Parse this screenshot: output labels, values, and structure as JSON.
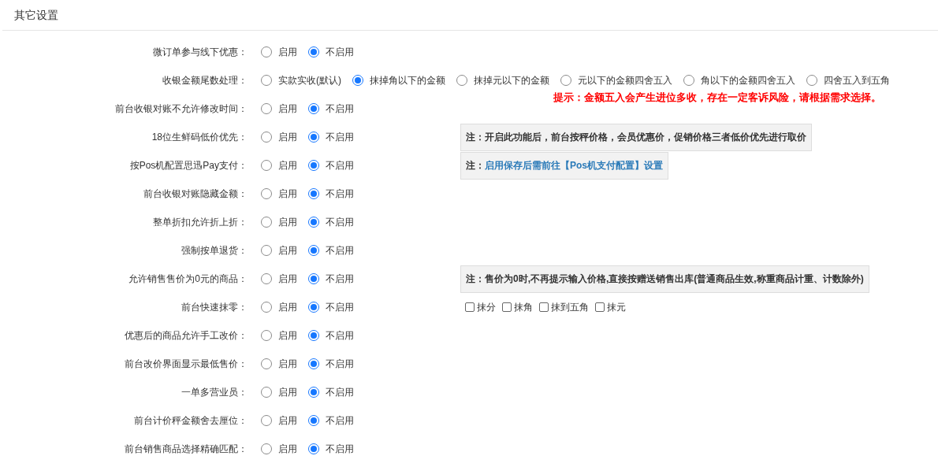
{
  "title": "其它设置",
  "rows": [
    {
      "label": "微订单参与线下优惠：",
      "options": [
        {
          "label": "启用",
          "selected": false
        },
        {
          "label": "不启用",
          "selected": true
        }
      ]
    },
    {
      "label": "收银金额尾数处理：",
      "options": [
        {
          "label": "实款实收(默认)",
          "selected": false
        },
        {
          "label": "抹掉角以下的金额",
          "selected": true
        },
        {
          "label": "抹掉元以下的金额",
          "selected": false
        },
        {
          "label": "元以下的金额四舍五入",
          "selected": false
        },
        {
          "label": "角以下的金额四舍五入",
          "selected": false
        },
        {
          "label": "四舍五入到五角",
          "selected": false
        }
      ],
      "hint": "提示：金额五入会产生进位多收，存在一定客诉风险，请根据需求选择。"
    },
    {
      "label": "前台收银对账不允许修改时间：",
      "options": [
        {
          "label": "启用",
          "selected": false
        },
        {
          "label": "不启用",
          "selected": true
        }
      ]
    },
    {
      "label": "18位生鲜码低价优先：",
      "options": [
        {
          "label": "启用",
          "selected": false
        },
        {
          "label": "不启用",
          "selected": true
        }
      ],
      "note": {
        "kind": "plain",
        "prefix": "注：",
        "text": "开启此功能后，前台按秤价格，会员优惠价，促销价格三者低价优先进行取价"
      }
    },
    {
      "label": "按Pos机配置思迅Pay支付：",
      "options": [
        {
          "label": "启用",
          "selected": false
        },
        {
          "label": "不启用",
          "selected": true
        }
      ],
      "note": {
        "kind": "link",
        "prefix": "注：",
        "text": "启用保存后需前往【Pos机支付配置】设置"
      }
    },
    {
      "label": "前台收银对账隐藏金额：",
      "options": [
        {
          "label": "启用",
          "selected": false
        },
        {
          "label": "不启用",
          "selected": true
        }
      ]
    },
    {
      "label": "整单折扣允许折上折：",
      "options": [
        {
          "label": "启用",
          "selected": false
        },
        {
          "label": "不启用",
          "selected": true
        }
      ]
    },
    {
      "label": "强制按单退货：",
      "options": [
        {
          "label": "启用",
          "selected": false
        },
        {
          "label": "不启用",
          "selected": true
        }
      ]
    },
    {
      "label": "允许销售售价为0元的商品：",
      "options": [
        {
          "label": "启用",
          "selected": false
        },
        {
          "label": "不启用",
          "selected": true
        }
      ],
      "note": {
        "kind": "plain",
        "prefix": "注：",
        "text": "售价为0时,不再提示输入价格,直接按赠送销售出库(普通商品生效,称重商品计重、计数除外)"
      }
    },
    {
      "label": "前台快速抹零：",
      "options": [
        {
          "label": "启用",
          "selected": false
        },
        {
          "label": "不启用",
          "selected": true
        }
      ],
      "checkboxes": [
        {
          "label": "抹分",
          "checked": false
        },
        {
          "label": "抹角",
          "checked": false
        },
        {
          "label": "抹到五角",
          "checked": false
        },
        {
          "label": "抹元",
          "checked": false
        }
      ]
    },
    {
      "label": "优惠后的商品允许手工改价：",
      "options": [
        {
          "label": "启用",
          "selected": false
        },
        {
          "label": "不启用",
          "selected": true
        }
      ]
    },
    {
      "label": "前台改价界面显示最低售价：",
      "options": [
        {
          "label": "启用",
          "selected": false
        },
        {
          "label": "不启用",
          "selected": true
        }
      ]
    },
    {
      "label": "一单多营业员：",
      "options": [
        {
          "label": "启用",
          "selected": false
        },
        {
          "label": "不启用",
          "selected": true
        }
      ]
    },
    {
      "label": "前台计价秤金额舍去厘位：",
      "options": [
        {
          "label": "启用",
          "selected": false
        },
        {
          "label": "不启用",
          "selected": true
        }
      ]
    },
    {
      "label": "前台销售商品选择精确匹配：",
      "options": [
        {
          "label": "启用",
          "selected": false
        },
        {
          "label": "不启用",
          "selected": true
        }
      ]
    }
  ]
}
